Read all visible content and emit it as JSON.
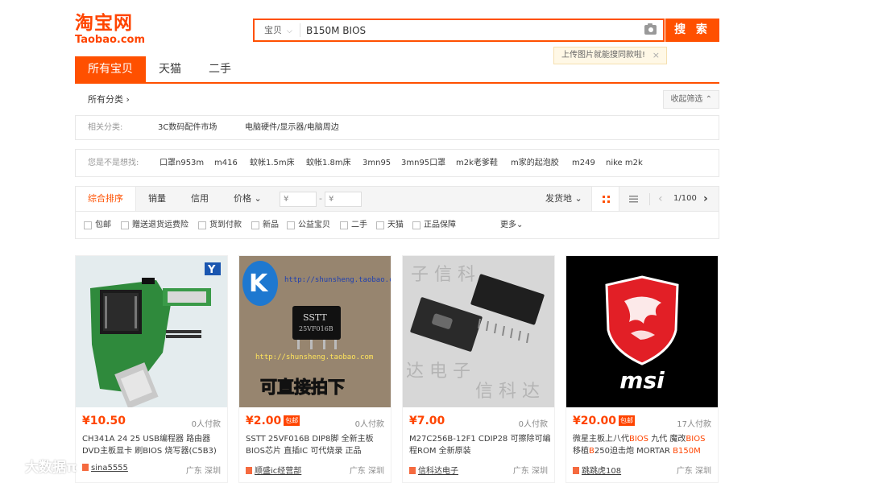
{
  "logo": {
    "cn": "淘宝网",
    "en": "Taobao.com"
  },
  "search": {
    "type_label": "宝贝",
    "query": "B150M BIOS",
    "button": "搜 索",
    "tip": "上传图片就能搜同款啦!",
    "tip_close": "×"
  },
  "tabs": [
    "所有宝贝",
    "天猫",
    "二手"
  ],
  "crumb": {
    "label": "所有分类 ›",
    "collapse": "收起筛选 ⌃"
  },
  "related": {
    "label": "相关分类:",
    "items": [
      "3C数码配件市场",
      "电脑硬件/显示器/电脑周边"
    ]
  },
  "guess": {
    "label": "您是不是想找:",
    "items": [
      "口罩n953m",
      "m416",
      "蚊帐1.5m床",
      "蚊帐1.8m床",
      "3mn95",
      "3mn95口罩",
      "m2k老爹鞋",
      "m家的起泡胶",
      "m249",
      "nike m2k"
    ]
  },
  "sort": {
    "items": [
      "综合排序",
      "销量",
      "信用",
      "价格 ⌄"
    ],
    "price_from": "¥",
    "price_to": "¥",
    "dash": "-",
    "ship_from": "发货地 ⌄",
    "page": "1/100",
    "prev": "‹",
    "next": "›"
  },
  "filters": {
    "items": [
      "包邮",
      "赠送退货运费险",
      "货到付款",
      "新品",
      "公益宝贝",
      "二手",
      "天猫",
      "正品保障"
    ],
    "more": "更多⌄"
  },
  "products": [
    {
      "price": "¥10.50",
      "baoyou": "",
      "paid": "0人付款",
      "title_parts": [
        {
          "t": "CH341A 24 25 USB编程器 路由器 DVD主板显卡 刷BIOS 烧写器(C5B3)",
          "hl": false
        }
      ],
      "shop": "sina5555",
      "loc": "广东 深圳"
    },
    {
      "price": "¥2.00",
      "baoyou": "包邮",
      "paid": "0人付款",
      "title_parts": [
        {
          "t": "SSTT 25VF016B DIP8脚 全新主板BIOS芯片 直插IC 可代烧录 正品",
          "hl": false
        }
      ],
      "shop": "顺盛ic经营部",
      "loc": "广东 深圳"
    },
    {
      "price": "¥7.00",
      "baoyou": "",
      "paid": "0人付款",
      "title_parts": [
        {
          "t": "M27C256B-12F1 CDIP28 可擦除可编程ROM 全新原装",
          "hl": false
        }
      ],
      "shop": "信科达电子",
      "loc": "广东 深圳"
    },
    {
      "price": "¥20.00",
      "baoyou": "包邮",
      "paid": "17人付款",
      "title_parts": [
        {
          "t": "微星主板上八代",
          "hl": false
        },
        {
          "t": "BIOS",
          "hl": true
        },
        {
          "t": " 九代 魔改",
          "hl": false
        },
        {
          "t": "BIOS",
          "hl": true
        },
        {
          "t": " 移植",
          "hl": false
        },
        {
          "t": "B",
          "hl": true
        },
        {
          "t": "250迫击炮 MORTAR ",
          "hl": false
        },
        {
          "t": "B150M",
          "hl": true
        }
      ],
      "shop": "跳跳虎108",
      "loc": "广东 深圳"
    }
  ],
  "image_text": {
    "p2_chip": "SSTT",
    "p2_chip2": "25VF016B",
    "p2_url": "http://shunsheng.taobao.com",
    "p2_caption": "可直接拍下",
    "p4_brand": "msi"
  },
  "watermark": "大数据π",
  "colors": {
    "accent": "#ff5000",
    "price": "#ff4400"
  }
}
